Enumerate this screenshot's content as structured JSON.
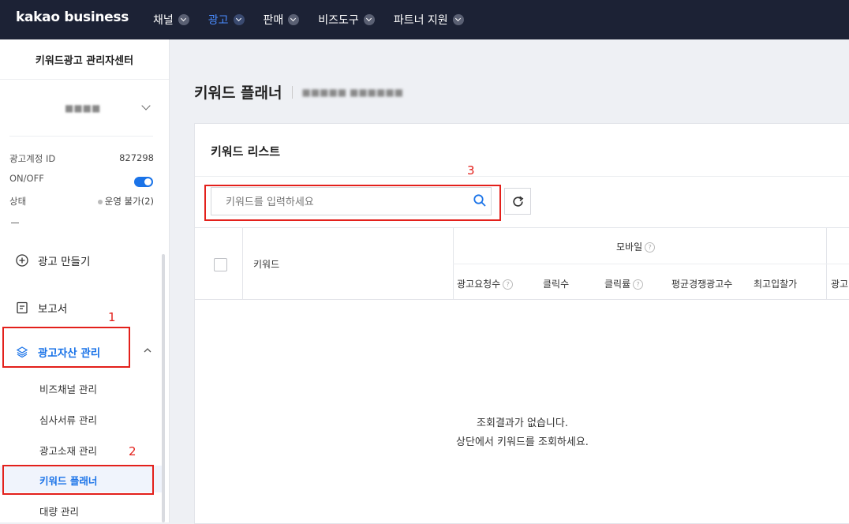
{
  "header": {
    "logo": "kakao business",
    "nav": [
      {
        "label": "채널",
        "active": false
      },
      {
        "label": "광고",
        "active": true
      },
      {
        "label": "판매",
        "active": false
      },
      {
        "label": "비즈도구",
        "active": false
      },
      {
        "label": "파트너 지원",
        "active": false
      }
    ]
  },
  "sidebar": {
    "title": "키워드광고 관리자센터",
    "account_name": "■■■■",
    "ad_account_id_label": "광고계정 ID",
    "ad_account_id_value": "827298",
    "onoff_label": "ON/OFF",
    "onoff_state": "on",
    "status_label": "상태",
    "status_value": "운영 불가(2)",
    "menu": {
      "create_ad": "광고 만들기",
      "report": "보고서",
      "asset_manage": "광고자산 관리"
    },
    "submenu": [
      "비즈채널 관리",
      "심사서류 관리",
      "광고소재 관리",
      "키워드 플래너",
      "대량 관리"
    ],
    "active_submenu": "키워드 플래너"
  },
  "main": {
    "page_title": "키워드 플래너",
    "account_blurred": "■■■■■ ■■■■■■",
    "card_title": "키워드 리스트",
    "search_placeholder": "키워드를 입력하세요",
    "table": {
      "col_keyword": "키워드",
      "group_mobile": "모바일",
      "mobile_cols": [
        "광고요청수",
        "클릭수",
        "클릭률",
        "평균경쟁광고수",
        "최고입찰가",
        "광고"
      ]
    },
    "empty_line1": "조회결과가 없습니다.",
    "empty_line2": "상단에서 키워드를 조회하세요."
  },
  "annotations": [
    "1",
    "2",
    "3"
  ],
  "colors": {
    "accent": "#1a73e8",
    "topbar": "#1c2235",
    "highlight": "#e3201b"
  }
}
